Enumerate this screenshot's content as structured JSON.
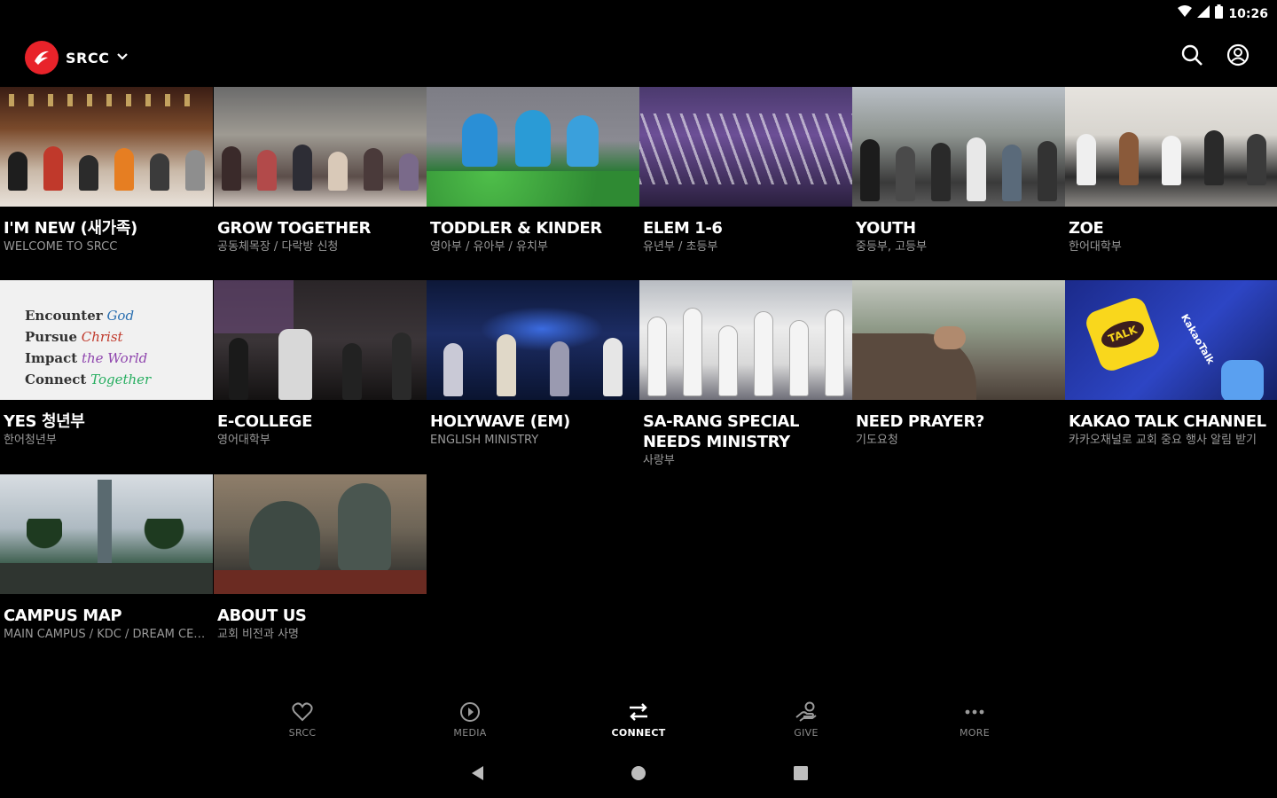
{
  "status_bar": {
    "time": "10:26"
  },
  "header": {
    "org_name": "SRCC",
    "search_icon": "search-icon",
    "account_icon": "account-circle-icon"
  },
  "tiles": [
    {
      "title": "I'M NEW (새가족)",
      "subtitle": "WELCOME TO SRCC"
    },
    {
      "title": "GROW TOGETHER",
      "subtitle": "공동체목장 / 다락방 신청"
    },
    {
      "title": "TODDLER & KINDER",
      "subtitle": "영아부 / 유아부 / 유치부"
    },
    {
      "title": "ELEM 1-6",
      "subtitle": "유년부 / 초등부"
    },
    {
      "title": "YOUTH",
      "subtitle": "중등부, 고등부"
    },
    {
      "title": "ZOE",
      "subtitle": "한어대학부"
    },
    {
      "title": "YES 청년부",
      "subtitle": "한어청년부"
    },
    {
      "title": "E-COLLEGE",
      "subtitle": "영어대학부"
    },
    {
      "title": "HOLYWAVE (EM)",
      "subtitle": "ENGLISH MINISTRY"
    },
    {
      "title": "SA-RANG SPECIAL NEEDS MINISTRY",
      "subtitle": "사랑부"
    },
    {
      "title": "NEED PRAYER?",
      "subtitle": "기도요청"
    },
    {
      "title": "KAKAO TALK CHANNEL",
      "subtitle": "카카오채널로 교회 중요 행사 알림 받기"
    },
    {
      "title": "CAMPUS MAP",
      "subtitle": "MAIN CAMPUS / KDC / DREAM CENTER"
    },
    {
      "title": "ABOUT US",
      "subtitle": "교회 비전과 사명"
    }
  ],
  "yes_image_text": {
    "line1_a": "Encounter",
    "line1_b": " God",
    "line2_a": "Pursue",
    "line2_b": " Christ",
    "line3_a": "Impact",
    "line3_b": " the World",
    "line4_a": "Connect",
    "line4_b": " Together"
  },
  "kakao_image_text": {
    "talk": "TALK",
    "brand": "KakaoTalk"
  },
  "bottom_nav": [
    {
      "label": "SRCC",
      "icon": "heart-icon"
    },
    {
      "label": "MEDIA",
      "icon": "play-circle-icon"
    },
    {
      "label": "CONNECT",
      "icon": "swap-arrows-icon",
      "active": true
    },
    {
      "label": "GIVE",
      "icon": "give-hand-icon"
    },
    {
      "label": "MORE",
      "icon": "more-dots-icon"
    }
  ],
  "colors": {
    "background": "#000000",
    "brand_red": "#e8232a",
    "subtitle_gray": "#9a9a9a"
  }
}
